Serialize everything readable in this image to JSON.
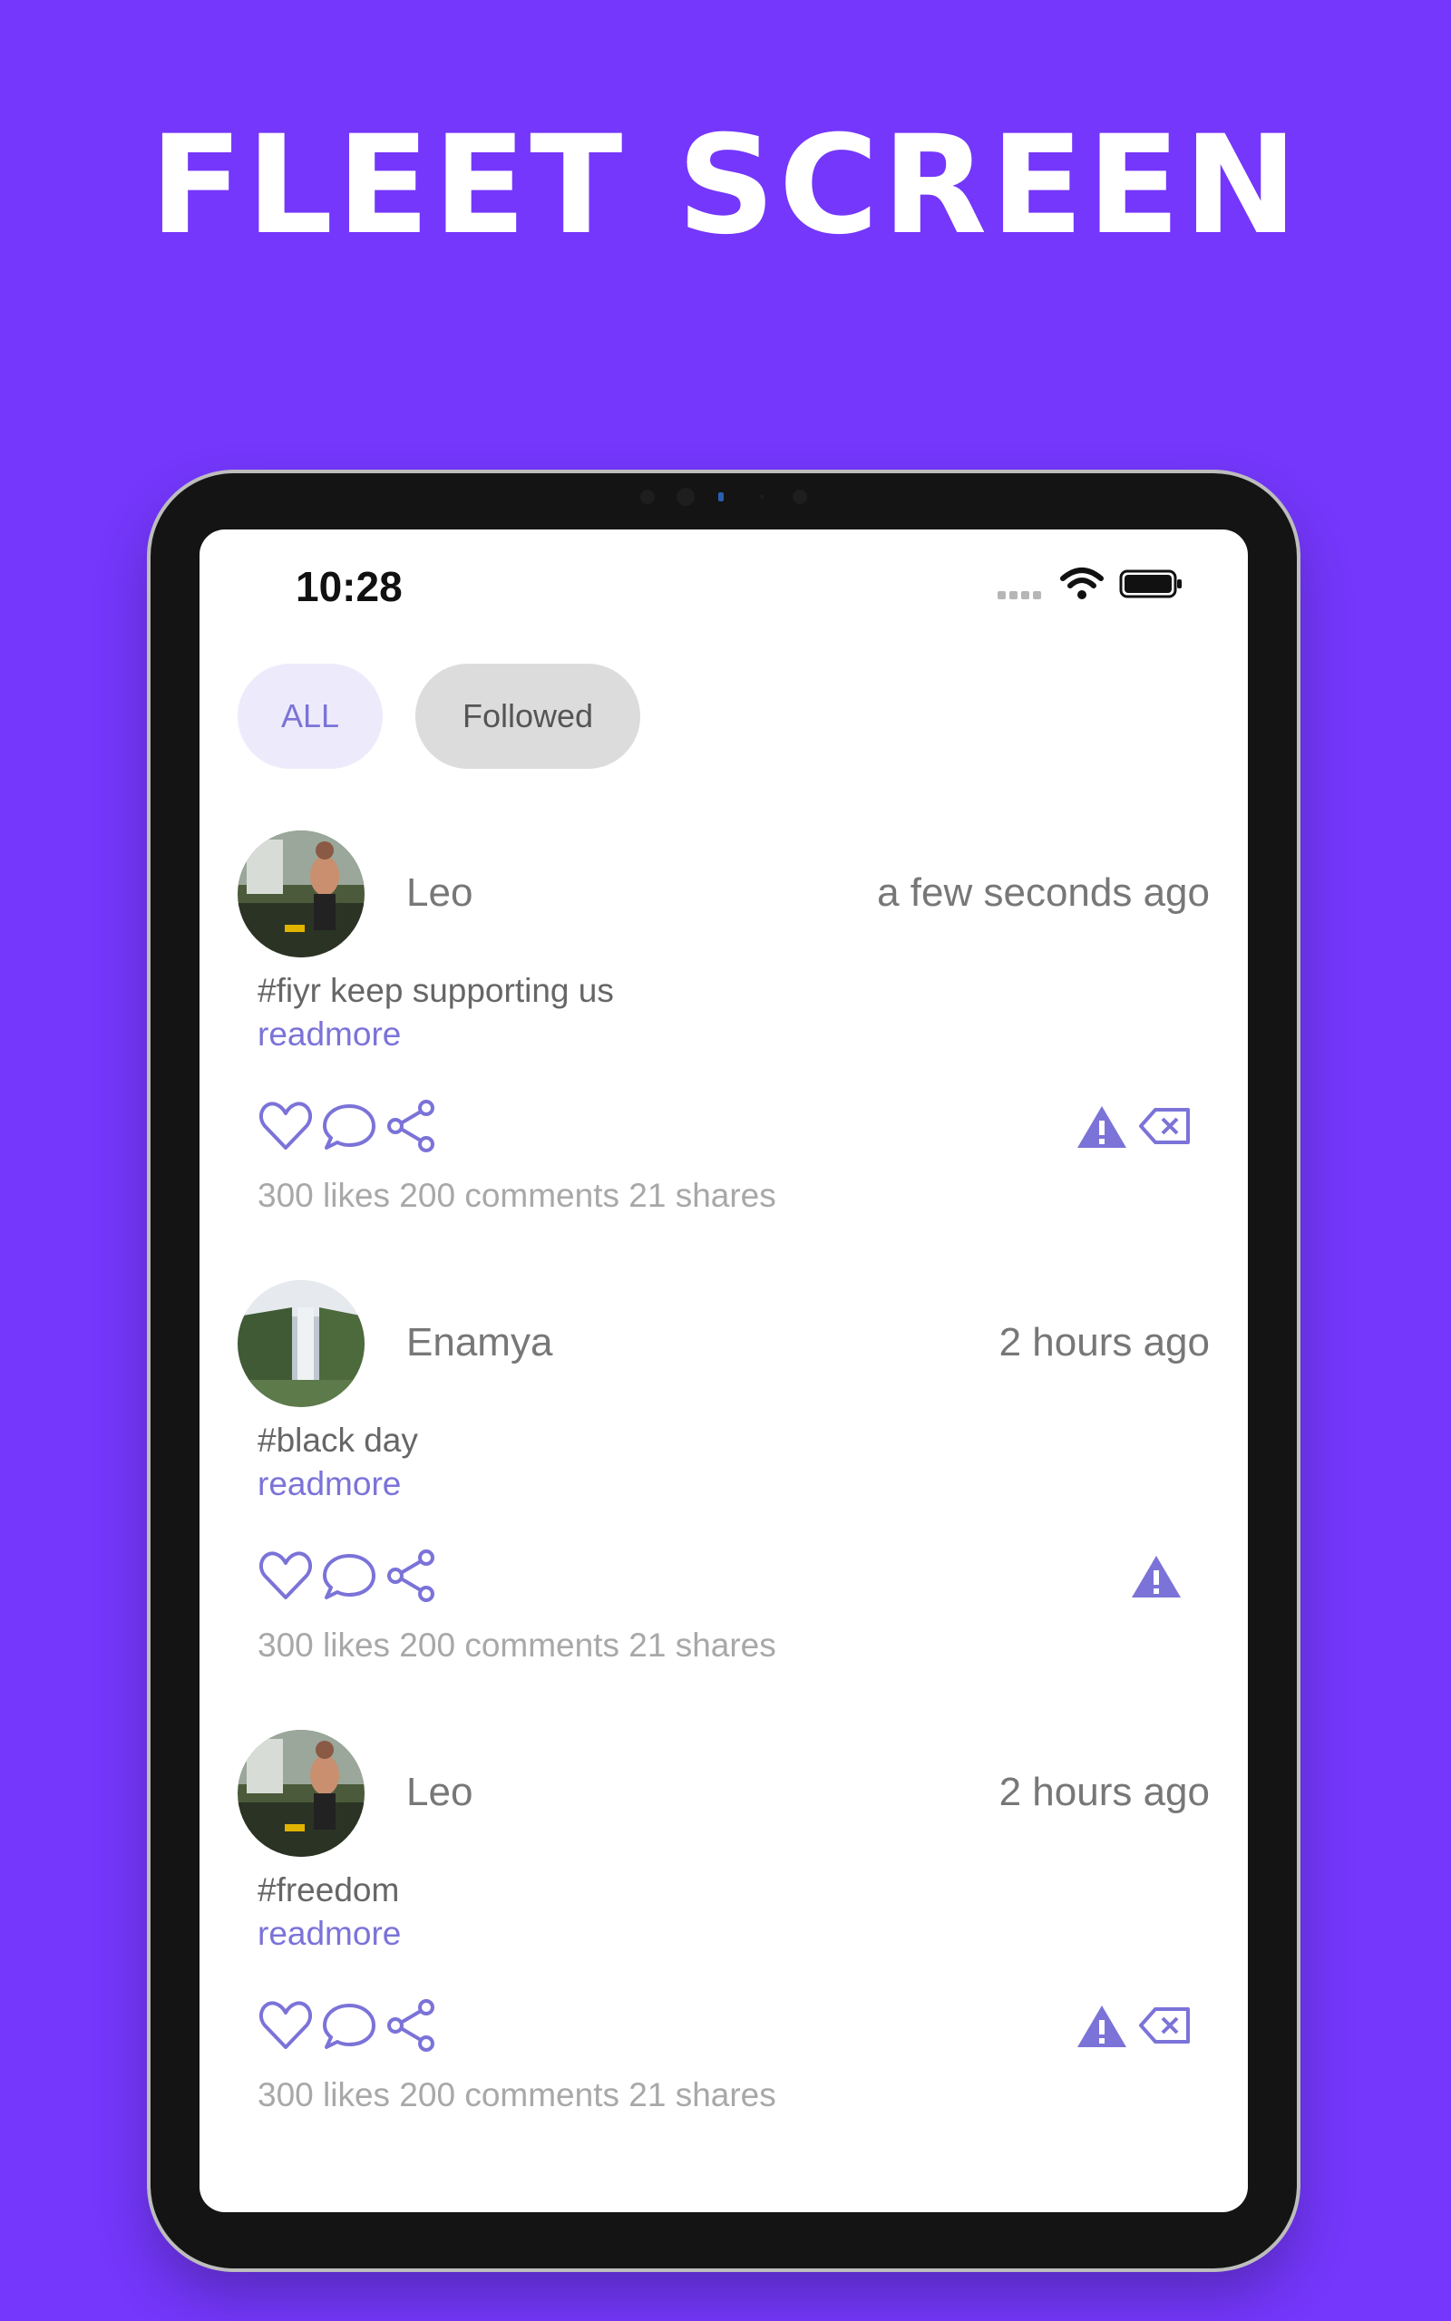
{
  "headline": "FLEET SCREEN",
  "status_bar": {
    "time": "10:28"
  },
  "tabs": [
    {
      "label": "ALL",
      "active": true
    },
    {
      "label": "Followed",
      "active": false
    }
  ],
  "colors": {
    "background": "#7437FB",
    "accent": "#7B73D8",
    "muted_text": "#777777"
  },
  "icons": [
    "heart-icon",
    "comment-icon",
    "share-icon",
    "warning-icon",
    "backspace-icon"
  ],
  "posts": [
    {
      "user": "Leo",
      "time": "a few seconds ago",
      "caption": "#fiyr keep supporting us",
      "readmore": "readmore",
      "stats": "300 likes 200 comments 21 shares",
      "has_delete": true
    },
    {
      "user": "Enamya",
      "time": "2 hours ago",
      "caption": "#black day",
      "readmore": "readmore",
      "stats": "300 likes 200 comments 21 shares",
      "has_delete": false
    },
    {
      "user": "Leo",
      "time": "2 hours ago",
      "caption": "#freedom",
      "readmore": "readmore",
      "stats": "300 likes 200 comments 21 shares",
      "has_delete": true
    }
  ]
}
